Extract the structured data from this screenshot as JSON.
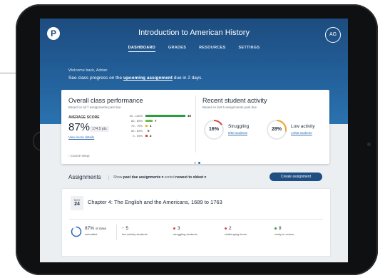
{
  "header": {
    "logo_text": "P",
    "course_title": "Introduction to American History",
    "avatar_initials": "AG",
    "nav": [
      "DASHBOARD",
      "GRADES",
      "RESOURCES",
      "SETTINGS"
    ]
  },
  "hero": {
    "welcome": "Welcome back, Adrian",
    "progress_prefix": "See class progress on the ",
    "progress_link": "upcoming assignment",
    "progress_suffix": " due in 2 days."
  },
  "performance": {
    "title": "Overall class performance",
    "subtitle": "Based on all 7 assignments past due",
    "avg_label": "AVERAGE SCORE",
    "avg_value": "87%",
    "avg_points": "174.5 pts",
    "score_details_link": "View score details",
    "distribution": [
      {
        "range": "90 - 100%",
        "count": "40",
        "value": 40,
        "color": "#2f9a42"
      },
      {
        "range": "80 - 89%",
        "count": "7",
        "value": 7,
        "color": "#6cbf4b"
      },
      {
        "range": "70 - 79%",
        "count": "1",
        "value": 1,
        "color": "#f0b429"
      },
      {
        "range": "60 - 69%",
        "count": "0",
        "value": 0,
        "color": "#f08a24"
      },
      {
        "range": "0 - 59%",
        "count": "2",
        "value": 2,
        "color": "#d64545"
      }
    ],
    "course_setup": "‹ Course setup"
  },
  "activity": {
    "title": "Recent student activity",
    "subtitle": "Based on last 5 assignments past due",
    "struggling": {
      "percent_label": "16%",
      "fraction": 0.16,
      "label": "Struggling",
      "link": "8/50 students",
      "color": "#d64545"
    },
    "low_activity": {
      "percent_label": "28%",
      "fraction": 0.28,
      "label": "Low activity",
      "link": "14/50 students",
      "color": "#f0a030"
    }
  },
  "assignments": {
    "heading": "Assignments",
    "filter_show": "Show",
    "filter_value": "past due assignments ▾",
    "filter_sorted": "sorted",
    "filter_sort_value": "newest to oldest ▾",
    "create_button": "Create assignment",
    "item": {
      "month": "NOV",
      "day": "24",
      "title": "Chapter 4: The English and the Americans, 1689 to 1763",
      "submitted_value": "87%",
      "submitted_suffix": "of class",
      "submitted_label": "submitted",
      "submitted_fraction": 0.87,
      "stats": [
        {
          "value": "5",
          "label": "low activity students",
          "color": "#f0a030",
          "icon": "plus-icon"
        },
        {
          "value": "3",
          "label": "struggling students",
          "color": "#d64545",
          "icon": "dot-icon"
        },
        {
          "value": "2",
          "label": "challenging items",
          "color": "#d64545",
          "icon": "dot-icon"
        },
        {
          "value": "8",
          "label": "ready to review",
          "color": "#2f9a42",
          "icon": "dot-icon"
        }
      ]
    }
  }
}
